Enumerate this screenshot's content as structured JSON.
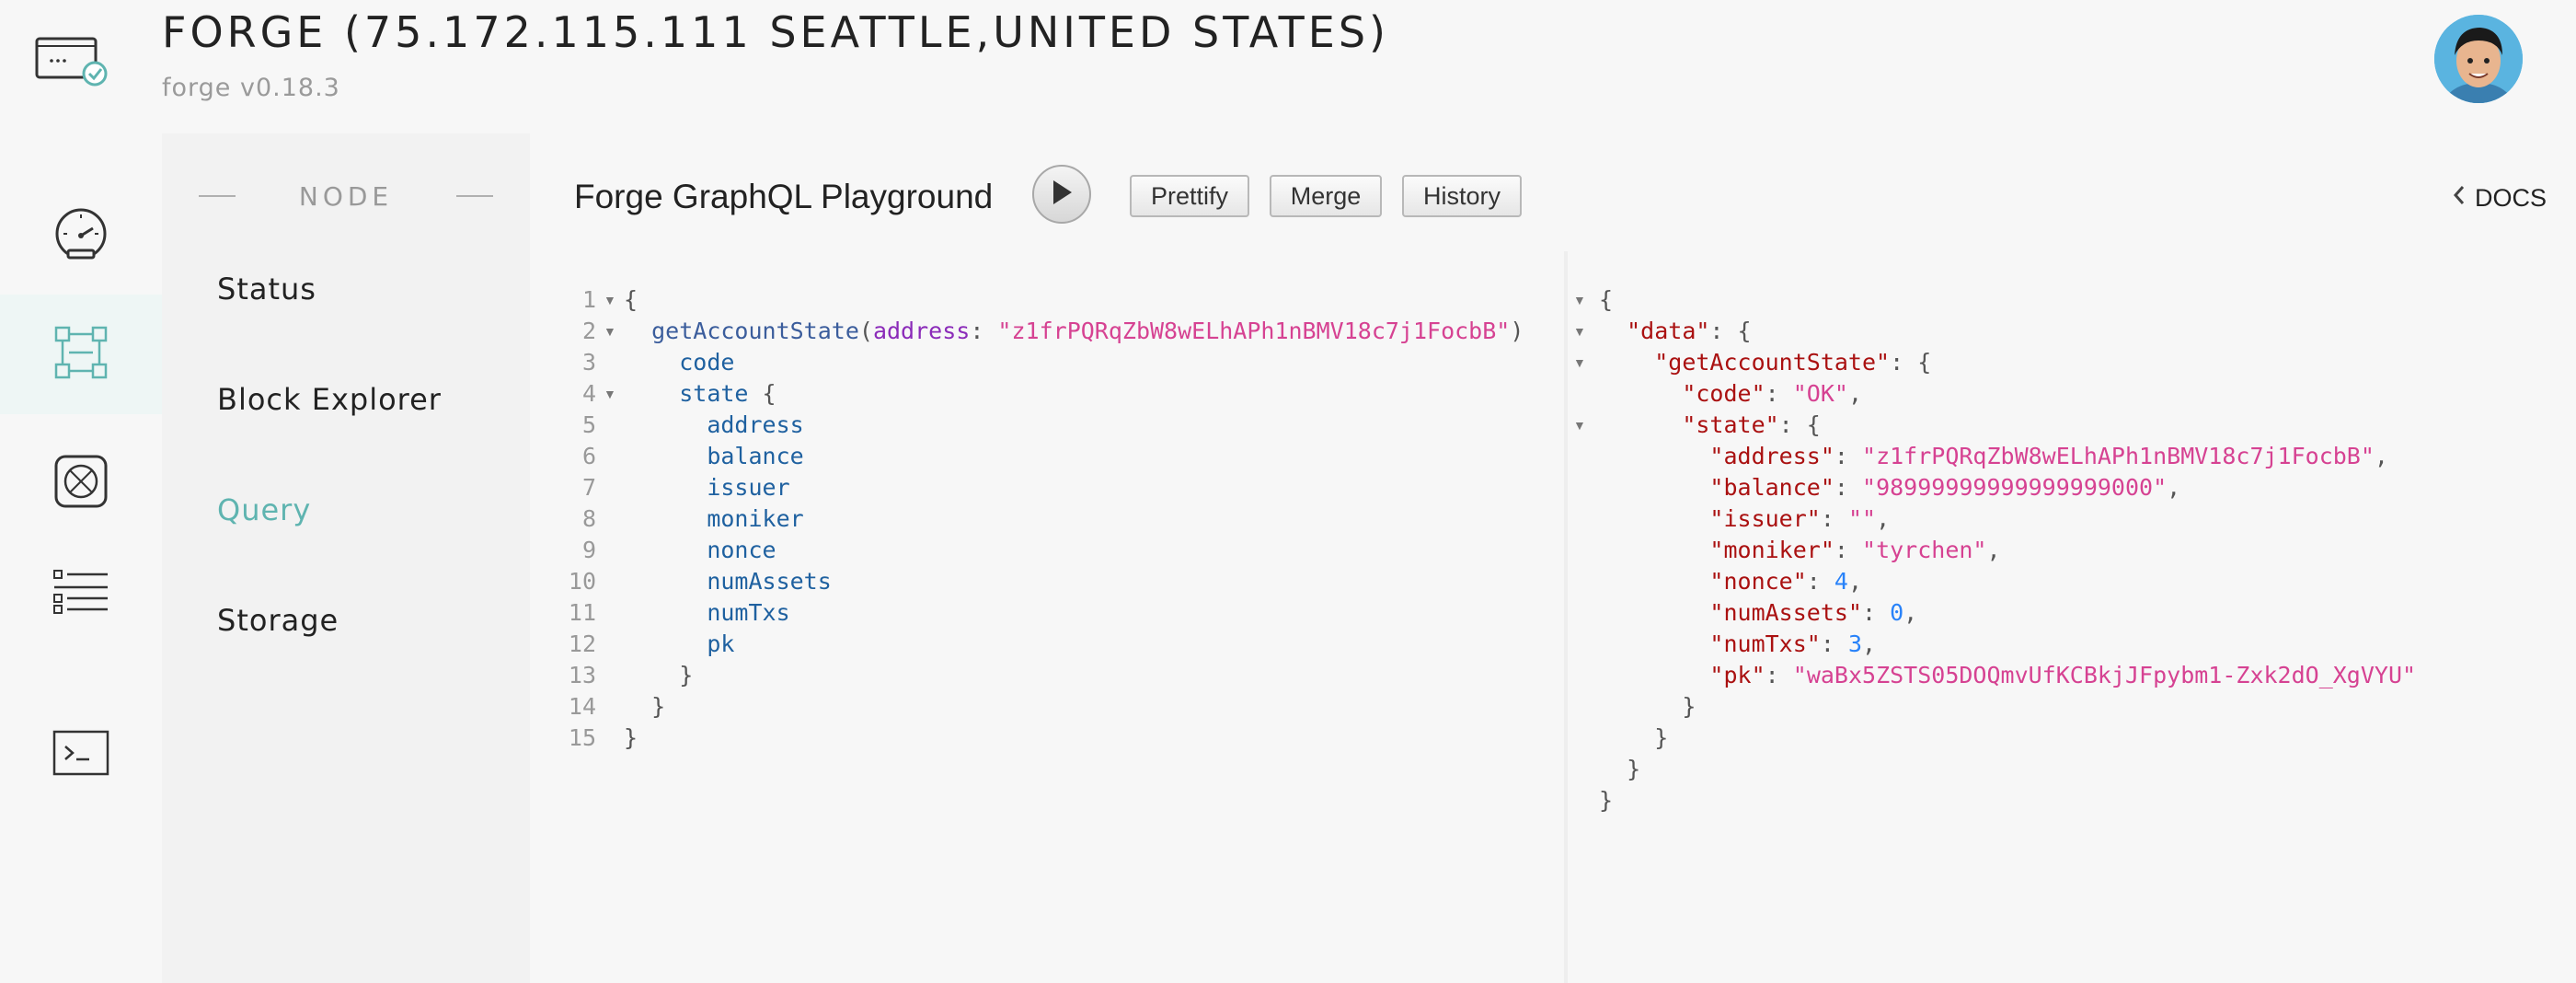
{
  "header": {
    "title": "FORGE (75.172.115.111 SEATTLE,UNITED STATES)",
    "subtitle": "forge v0.18.3",
    "logo_icon": "terminal-check-icon",
    "avatar_icon": "user-avatar"
  },
  "rail": {
    "items": [
      {
        "icon": "speedometer-icon"
      },
      {
        "icon": "node-network-icon",
        "active": true
      },
      {
        "icon": "chip-icon"
      },
      {
        "icon": "list-icon"
      },
      {
        "icon": "terminal-icon"
      }
    ]
  },
  "subnav": {
    "heading": "NODE",
    "items": [
      {
        "label": "Status"
      },
      {
        "label": "Block Explorer"
      },
      {
        "label": "Query",
        "active": true
      },
      {
        "label": "Storage"
      }
    ]
  },
  "playground": {
    "title": "Forge GraphQL Playground",
    "buttons": {
      "prettify": "Prettify",
      "merge": "Merge",
      "history": "History"
    },
    "docs_label": "DOCS",
    "query_address": "z1frPQRqZbW8wELhAPh1nBMV18c7j1FocbB",
    "query_function": "getAccountState",
    "query_arg": "address",
    "query_fields": [
      "code",
      "state"
    ],
    "state_fields": [
      "address",
      "balance",
      "issuer",
      "moniker",
      "nonce",
      "numAssets",
      "numTxs",
      "pk"
    ],
    "result": {
      "code": "OK",
      "address": "z1frPQRqZbW8wELhAPh1nBMV18c7j1FocbB",
      "balance": "98999999999999999000",
      "issuer": "",
      "moniker": "tyrchen",
      "nonce": "4",
      "numAssets": "0",
      "numTxs": "3",
      "pk": "waBx5ZSTS05DOQmvUfKCBkjJFpybm1-Zxk2dO_XgVYU"
    }
  },
  "colors": {
    "accent": "#5fb4b0",
    "string": "#d64292",
    "number": "#2882f9",
    "field": "#1f61a0"
  }
}
